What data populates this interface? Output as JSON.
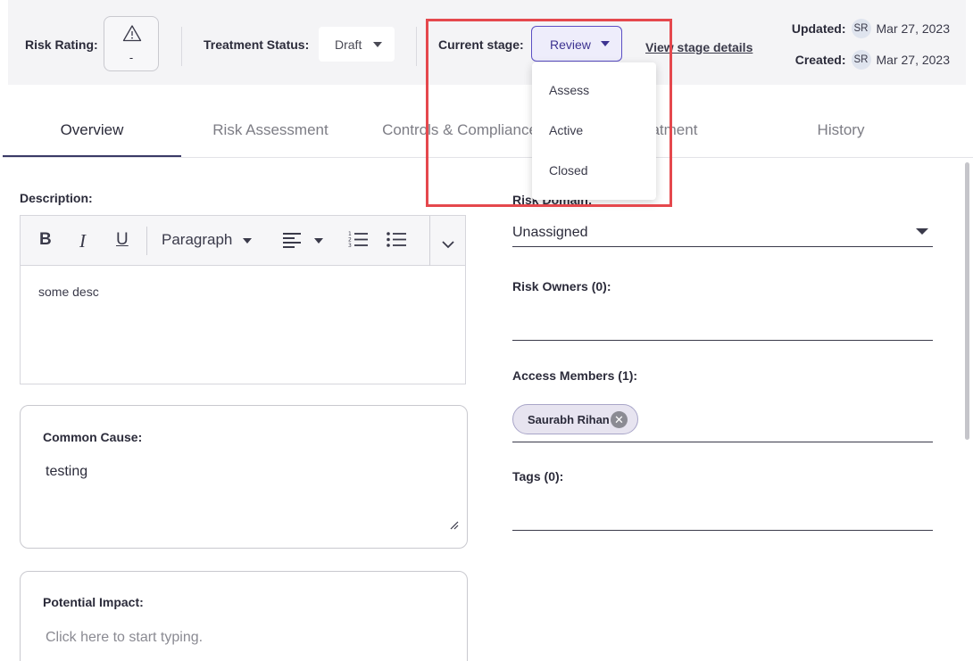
{
  "header": {
    "risk_rating_label": "Risk Rating:",
    "risk_rating_value": "-",
    "treatment_status_label": "Treatment Status:",
    "treatment_status_value": "Draft",
    "current_stage_label": "Current stage:",
    "current_stage_value": "Review",
    "view_stage_link": "View stage details",
    "updated_label": "Updated:",
    "updated_avatar": "SR",
    "updated_date": "Mar 27, 2023",
    "created_label": "Created:",
    "created_avatar": "SR",
    "created_date": "Mar 27, 2023"
  },
  "stage_dropdown": {
    "options": [
      "Assess",
      "Active",
      "Closed"
    ]
  },
  "tabs": [
    "Overview",
    "Risk Assessment",
    "Controls & Compliance",
    "Treatment",
    "History"
  ],
  "active_tab": "Overview",
  "left": {
    "description_label": "Description:",
    "editor": {
      "bold": "B",
      "italic": "I",
      "underline": "U",
      "paragraph_label": "Paragraph",
      "body_text": "some desc"
    },
    "common_cause": {
      "label": "Common Cause:",
      "value": "testing"
    },
    "potential_impact": {
      "label": "Potential Impact:",
      "placeholder": "Click here to start typing."
    }
  },
  "right": {
    "risk_domain": {
      "label": "Risk Domain:",
      "value": "Unassigned"
    },
    "risk_owners_label": "Risk Owners (0):",
    "access_members_label": "Access Members (1):",
    "access_members": [
      "Saurabh Rihan"
    ],
    "tags_label": "Tags (0):"
  },
  "colors": {
    "accent": "#5b4fc4",
    "highlight": "#e5484d",
    "header_bg": "#f4f4f6"
  }
}
